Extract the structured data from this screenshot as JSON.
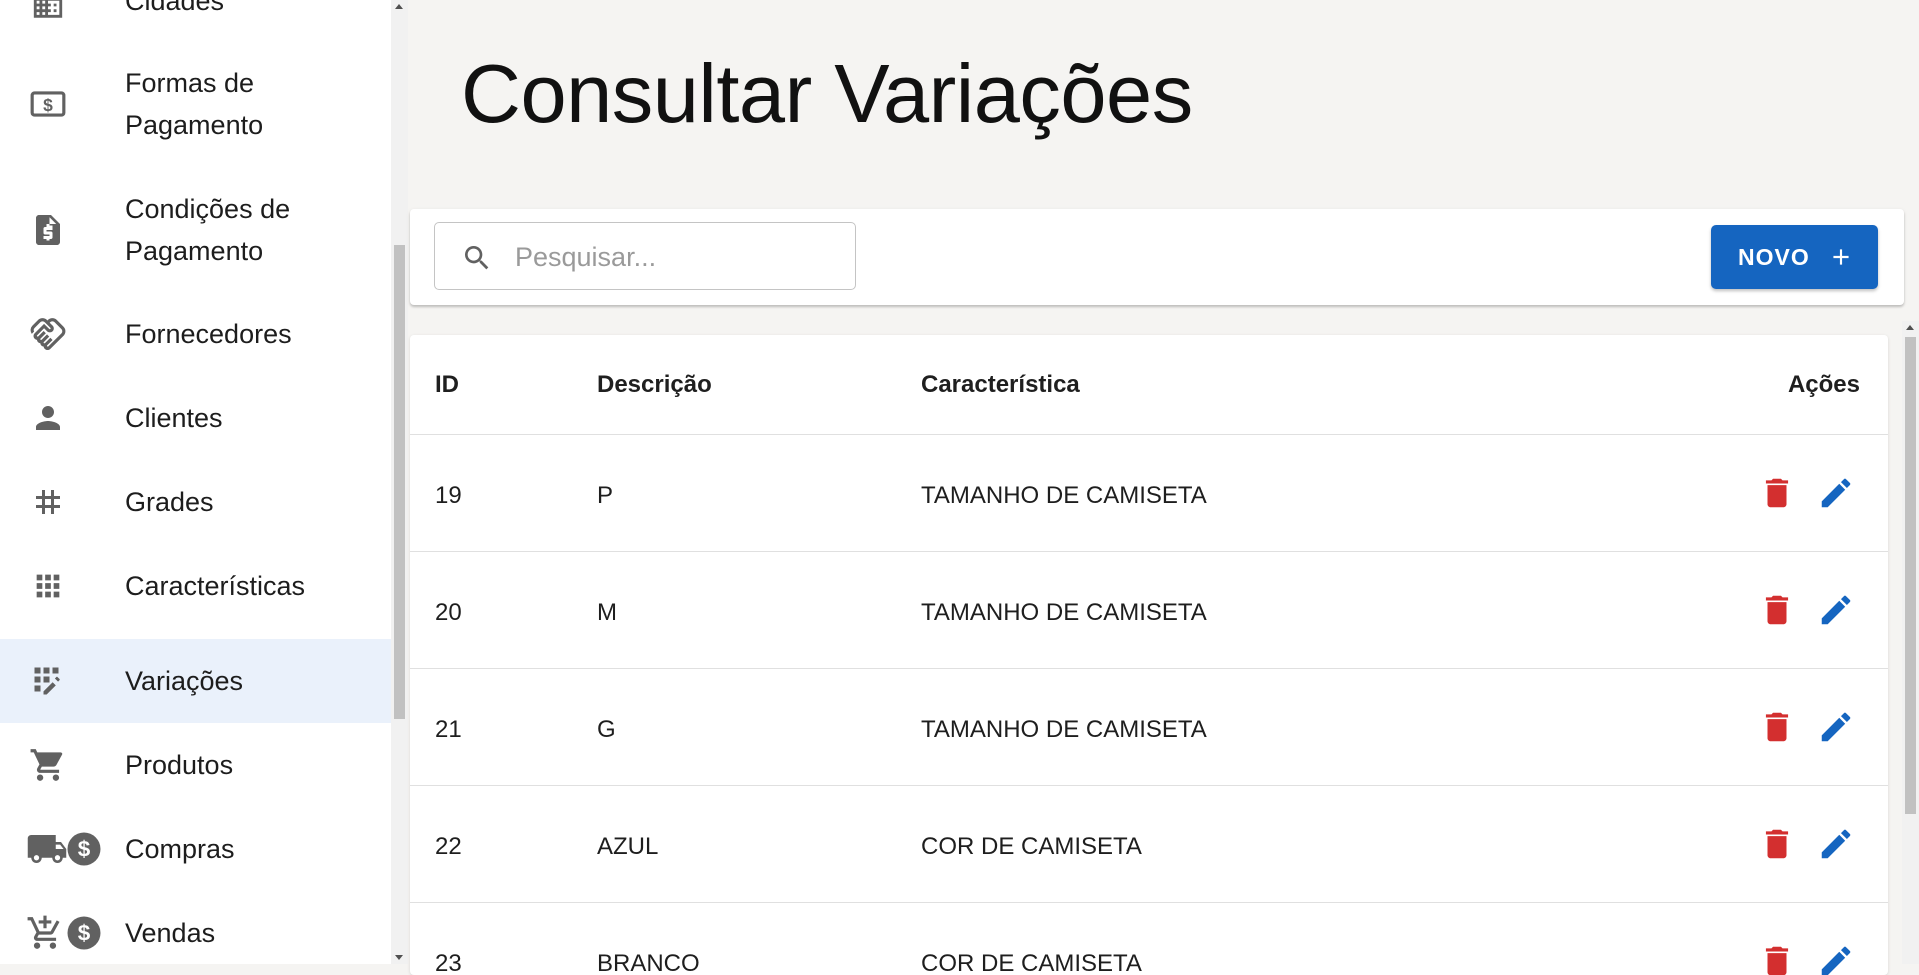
{
  "sidebar": {
    "items": [
      {
        "label": "Cidades",
        "icon": "building-icon"
      },
      {
        "label": "Formas de Pagamento",
        "icon": "payment-money-icon"
      },
      {
        "label": "Condições de Pagamento",
        "icon": "request-quote-icon"
      },
      {
        "label": "Fornecedores",
        "icon": "handshake-icon"
      },
      {
        "label": "Clientes",
        "icon": "person-icon"
      },
      {
        "label": "Grades",
        "icon": "hashtag-icon"
      },
      {
        "label": "Características",
        "icon": "apps-grid-icon"
      },
      {
        "label": "Variações",
        "icon": "grid-edit-icon",
        "active": true
      },
      {
        "label": "Produtos",
        "icon": "shopping-cart-icon"
      },
      {
        "label": "Compras",
        "icon": "truck-dollar-icon"
      },
      {
        "label": "Vendas",
        "icon": "cart-add-dollar-icon"
      }
    ],
    "active_bg_color": "#eaf1fb",
    "icon_color": "#616161"
  },
  "page": {
    "title": "Consultar Variações"
  },
  "toolbar": {
    "search_placeholder": "Pesquisar...",
    "search_value": "",
    "new_button_label": "NOVO",
    "new_button_color": "#1565c0"
  },
  "table": {
    "columns": [
      "ID",
      "Descrição",
      "Característica",
      "Ações"
    ],
    "rows": [
      {
        "id": "19",
        "descricao": "P",
        "caracteristica": "TAMANHO DE CAMISETA"
      },
      {
        "id": "20",
        "descricao": "M",
        "caracteristica": "TAMANHO DE CAMISETA"
      },
      {
        "id": "21",
        "descricao": "G",
        "caracteristica": "TAMANHO DE CAMISETA"
      },
      {
        "id": "22",
        "descricao": "AZUL",
        "caracteristica": "COR DE CAMISETA"
      },
      {
        "id": "23",
        "descricao": "BRANCO",
        "caracteristica": "COR DE CAMISETA"
      }
    ],
    "delete_color": "#d32f2f",
    "edit_color": "#1565c0"
  }
}
